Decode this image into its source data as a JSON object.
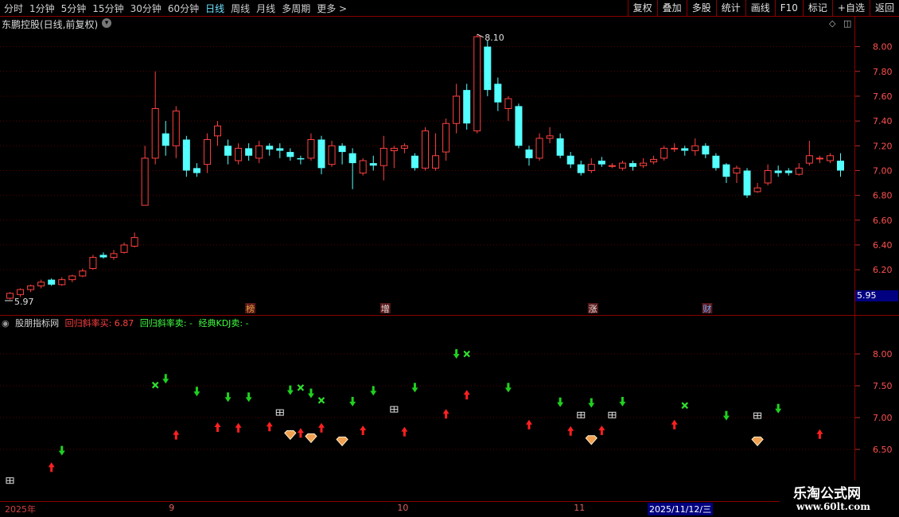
{
  "toolbar": {
    "periods": [
      "分时",
      "1分钟",
      "5分钟",
      "15分钟",
      "30分钟",
      "60分钟",
      "日线",
      "周线",
      "月线",
      "多周期",
      "更多 >"
    ],
    "active_period": "日线",
    "right_buttons": [
      "复权",
      "叠加",
      "多股",
      "统计",
      "画线",
      "F10",
      "标记",
      "+自选",
      "返回"
    ]
  },
  "stock": {
    "title": "东鹏控股(日线,前复权)",
    "high_label": "8.10",
    "low_label": "5.97",
    "current_price": "5.95"
  },
  "price_axis": [
    "8.00",
    "7.80",
    "7.60",
    "7.40",
    "7.20",
    "7.00",
    "6.80",
    "6.60",
    "6.40",
    "6.20"
  ],
  "indicator_axis": [
    "8.00",
    "7.50",
    "7.00",
    "6.50"
  ],
  "events": [
    {
      "label": "榜",
      "day": 23,
      "color": "#e8a040"
    },
    {
      "label": "增",
      "day": 36,
      "color": "#e0e0e0"
    },
    {
      "label": "涨",
      "day": 56,
      "color": "#e0e0e0"
    },
    {
      "label": "财",
      "day": 67,
      "color": "#6fa8ff"
    }
  ],
  "indicator": {
    "name": "股朋指标网",
    "buy": "回归斜率买: 6.87",
    "sell": "回归斜率卖: -",
    "kdj": "经典KDJ卖: -",
    "buy_color": "#ff4040",
    "sell_color": "#40ff40",
    "kdj_color": "#40ff40"
  },
  "dates": {
    "year": "2025年",
    "months": [
      {
        "label": "9",
        "day": 15.5
      },
      {
        "label": "10",
        "day": 37.5
      },
      {
        "label": "11",
        "day": 54.5
      }
    ],
    "selected": "2025/11/12/三"
  },
  "watermark": {
    "line1": "乐淘公式网",
    "line2": "www.60lt.com"
  },
  "chart_data": {
    "type": "candlestick",
    "ylim": [
      5.9,
      8.2
    ],
    "up_color": "#ff4040",
    "down_color": "#54ffff",
    "candles": [
      [
        5.97,
        6.01,
        6.02,
        5.96
      ],
      [
        6.0,
        6.04,
        6.05,
        5.98
      ],
      [
        6.04,
        6.07,
        6.08,
        6.02
      ],
      [
        6.07,
        6.1,
        6.12,
        6.05
      ],
      [
        6.12,
        6.08,
        6.13,
        6.07
      ],
      [
        6.08,
        6.12,
        6.14,
        6.07
      ],
      [
        6.12,
        6.15,
        6.16,
        6.1
      ],
      [
        6.15,
        6.19,
        6.21,
        6.14
      ],
      [
        6.21,
        6.3,
        6.32,
        6.2
      ],
      [
        6.32,
        6.3,
        6.34,
        6.29
      ],
      [
        6.3,
        6.33,
        6.36,
        6.28
      ],
      [
        6.34,
        6.4,
        6.42,
        6.33
      ],
      [
        6.39,
        6.46,
        6.5,
        6.38
      ],
      [
        6.72,
        7.1,
        7.2,
        6.72
      ],
      [
        7.1,
        7.5,
        7.8,
        7.05
      ],
      [
        7.3,
        7.2,
        7.4,
        7.12
      ],
      [
        7.2,
        7.48,
        7.52,
        7.1
      ],
      [
        7.25,
        7.0,
        7.28,
        6.95
      ],
      [
        7.02,
        6.98,
        7.06,
        6.95
      ],
      [
        7.05,
        7.25,
        7.3,
        6.98
      ],
      [
        7.28,
        7.36,
        7.4,
        7.2
      ],
      [
        7.2,
        7.12,
        7.25,
        7.05
      ],
      [
        7.08,
        7.18,
        7.22,
        7.05
      ],
      [
        7.18,
        7.12,
        7.22,
        7.08
      ],
      [
        7.1,
        7.2,
        7.24,
        7.06
      ],
      [
        7.2,
        7.17,
        7.22,
        7.12
      ],
      [
        7.18,
        7.16,
        7.22,
        7.1
      ],
      [
        7.15,
        7.11,
        7.18,
        7.08
      ],
      [
        7.1,
        7.09,
        7.12,
        7.05
      ],
      [
        7.1,
        7.25,
        7.3,
        7.08
      ],
      [
        7.25,
        7.02,
        7.28,
        6.97
      ],
      [
        7.05,
        7.2,
        7.24,
        7.03
      ],
      [
        7.2,
        7.15,
        7.22,
        7.05
      ],
      [
        7.14,
        7.06,
        7.18,
        6.85
      ],
      [
        6.98,
        7.08,
        7.1,
        6.96
      ],
      [
        7.06,
        7.04,
        7.12,
        7.0
      ],
      [
        7.04,
        7.18,
        7.28,
        6.92
      ],
      [
        7.16,
        7.18,
        7.2,
        7.02
      ],
      [
        7.18,
        7.2,
        7.22,
        7.14
      ],
      [
        7.12,
        7.02,
        7.14,
        7.0
      ],
      [
        7.02,
        7.32,
        7.35,
        7.0
      ],
      [
        7.02,
        7.12,
        7.3,
        7.0
      ],
      [
        7.15,
        7.38,
        7.42,
        7.08
      ],
      [
        7.38,
        7.6,
        7.7,
        7.3
      ],
      [
        7.65,
        7.38,
        7.7,
        7.33
      ],
      [
        7.32,
        8.08,
        8.1,
        7.3
      ],
      [
        8.0,
        7.65,
        8.05,
        7.6
      ],
      [
        7.7,
        7.55,
        7.75,
        7.48
      ],
      [
        7.5,
        7.58,
        7.6,
        7.4
      ],
      [
        7.52,
        7.2,
        7.54,
        7.18
      ],
      [
        7.17,
        7.1,
        7.2,
        7.04
      ],
      [
        7.1,
        7.26,
        7.3,
        7.08
      ],
      [
        7.26,
        7.28,
        7.35,
        7.22
      ],
      [
        7.26,
        7.12,
        7.3,
        7.1
      ],
      [
        7.12,
        7.05,
        7.15,
        7.02
      ],
      [
        7.05,
        6.98,
        7.08,
        6.96
      ],
      [
        7.0,
        7.05,
        7.1,
        6.98
      ],
      [
        7.08,
        7.05,
        7.11,
        7.03
      ],
      [
        7.04,
        7.04,
        7.06,
        7.02
      ],
      [
        7.02,
        7.06,
        7.08,
        7.0
      ],
      [
        7.06,
        7.03,
        7.08,
        7.0
      ],
      [
        7.04,
        7.06,
        7.1,
        7.02
      ],
      [
        7.07,
        7.09,
        7.12,
        7.05
      ],
      [
        7.1,
        7.18,
        7.2,
        7.08
      ],
      [
        7.18,
        7.18,
        7.22,
        7.15
      ],
      [
        7.18,
        7.16,
        7.2,
        7.12
      ],
      [
        7.16,
        7.2,
        7.26,
        7.12
      ],
      [
        7.2,
        7.13,
        7.22,
        7.1
      ],
      [
        7.12,
        7.02,
        7.14,
        7.0
      ],
      [
        7.05,
        6.95,
        7.06,
        6.9
      ],
      [
        6.98,
        7.02,
        7.04,
        6.9
      ],
      [
        7.0,
        6.8,
        7.02,
        6.78
      ],
      [
        6.83,
        6.86,
        6.9,
        6.82
      ],
      [
        6.9,
        7.0,
        7.05,
        6.88
      ],
      [
        7.0,
        6.98,
        7.04,
        6.95
      ],
      [
        7.0,
        6.98,
        7.02,
        6.96
      ],
      [
        6.97,
        7.02,
        7.06,
        6.96
      ],
      [
        7.06,
        7.12,
        7.24,
        7.04
      ],
      [
        7.1,
        7.1,
        7.12,
        7.06
      ],
      [
        7.08,
        7.12,
        7.14,
        7.06
      ],
      [
        7.08,
        7.0,
        7.14,
        6.95
      ]
    ],
    "signals": [
      {
        "day": 0,
        "type": "box",
        "y": 6.01
      },
      {
        "day": 4,
        "type": "up",
        "y": 6.22
      },
      {
        "day": 5,
        "type": "down",
        "y": 6.48
      },
      {
        "day": 14,
        "type": "x",
        "y": 7.51
      },
      {
        "day": 15,
        "type": "down",
        "y": 7.61
      },
      {
        "day": 16,
        "type": "up",
        "y": 6.73
      },
      {
        "day": 18,
        "type": "down",
        "y": 7.41
      },
      {
        "day": 20,
        "type": "up",
        "y": 6.85
      },
      {
        "day": 21,
        "type": "down",
        "y": 7.32
      },
      {
        "day": 22,
        "type": "up",
        "y": 6.84
      },
      {
        "day": 23,
        "type": "down",
        "y": 7.32
      },
      {
        "day": 25,
        "type": "up",
        "y": 6.86
      },
      {
        "day": 26,
        "type": "box",
        "y": 7.08
      },
      {
        "day": 27,
        "type": "down",
        "y": 7.43
      },
      {
        "day": 27,
        "type": "diamond",
        "y": 6.72
      },
      {
        "day": 28,
        "type": "x",
        "y": 7.47
      },
      {
        "day": 28,
        "type": "up",
        "y": 6.76
      },
      {
        "day": 29,
        "type": "diamond",
        "y": 6.67
      },
      {
        "day": 29,
        "type": "down",
        "y": 7.38
      },
      {
        "day": 30,
        "type": "up",
        "y": 6.84
      },
      {
        "day": 30,
        "type": "x",
        "y": 7.27
      },
      {
        "day": 32,
        "type": "diamond",
        "y": 6.62
      },
      {
        "day": 33,
        "type": "down",
        "y": 7.25
      },
      {
        "day": 34,
        "type": "up",
        "y": 6.8
      },
      {
        "day": 35,
        "type": "down",
        "y": 7.42
      },
      {
        "day": 37,
        "type": "box",
        "y": 7.13
      },
      {
        "day": 38,
        "type": "up",
        "y": 6.78
      },
      {
        "day": 39,
        "type": "down",
        "y": 7.47
      },
      {
        "day": 42,
        "type": "up",
        "y": 7.06
      },
      {
        "day": 43,
        "type": "down",
        "y": 8.0
      },
      {
        "day": 44,
        "type": "x",
        "y": 8.0
      },
      {
        "day": 44,
        "type": "up",
        "y": 7.36
      },
      {
        "day": 48,
        "type": "down",
        "y": 7.47
      },
      {
        "day": 50,
        "type": "up",
        "y": 6.89
      },
      {
        "day": 53,
        "type": "down",
        "y": 7.24
      },
      {
        "day": 54,
        "type": "up",
        "y": 6.79
      },
      {
        "day": 55,
        "type": "box",
        "y": 7.04
      },
      {
        "day": 56,
        "type": "down",
        "y": 7.23
      },
      {
        "day": 56,
        "type": "diamond",
        "y": 6.64
      },
      {
        "day": 57,
        "type": "up",
        "y": 6.8
      },
      {
        "day": 58,
        "type": "box",
        "y": 7.04
      },
      {
        "day": 59,
        "type": "down",
        "y": 7.25
      },
      {
        "day": 64,
        "type": "up",
        "y": 6.89
      },
      {
        "day": 65,
        "type": "x",
        "y": 7.19
      },
      {
        "day": 69,
        "type": "down",
        "y": 7.03
      },
      {
        "day": 72,
        "type": "box",
        "y": 7.03
      },
      {
        "day": 72,
        "type": "diamond",
        "y": 6.62
      },
      {
        "day": 74,
        "type": "down",
        "y": 7.14
      },
      {
        "day": 78,
        "type": "up",
        "y": 6.74
      }
    ]
  }
}
